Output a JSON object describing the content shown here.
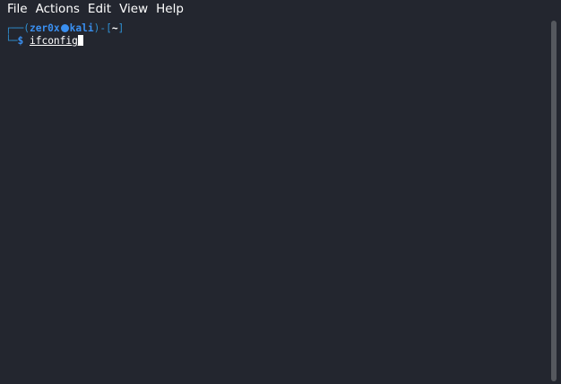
{
  "menu": {
    "items": [
      "File",
      "Actions",
      "Edit",
      "View",
      "Help"
    ]
  },
  "terminal": {
    "line1": {
      "frame_open": "┌──(",
      "user": "zer0x",
      "host": "kali",
      "frame_mid": ")-[",
      "cwd": "~",
      "frame_close": "]"
    },
    "line2": {
      "frame": "└─",
      "dollar": "$",
      "command": "ifconfig"
    }
  },
  "colors": {
    "background": "#23262f",
    "prompt_blue": "#3a8ff0",
    "text": "#ffffff"
  }
}
